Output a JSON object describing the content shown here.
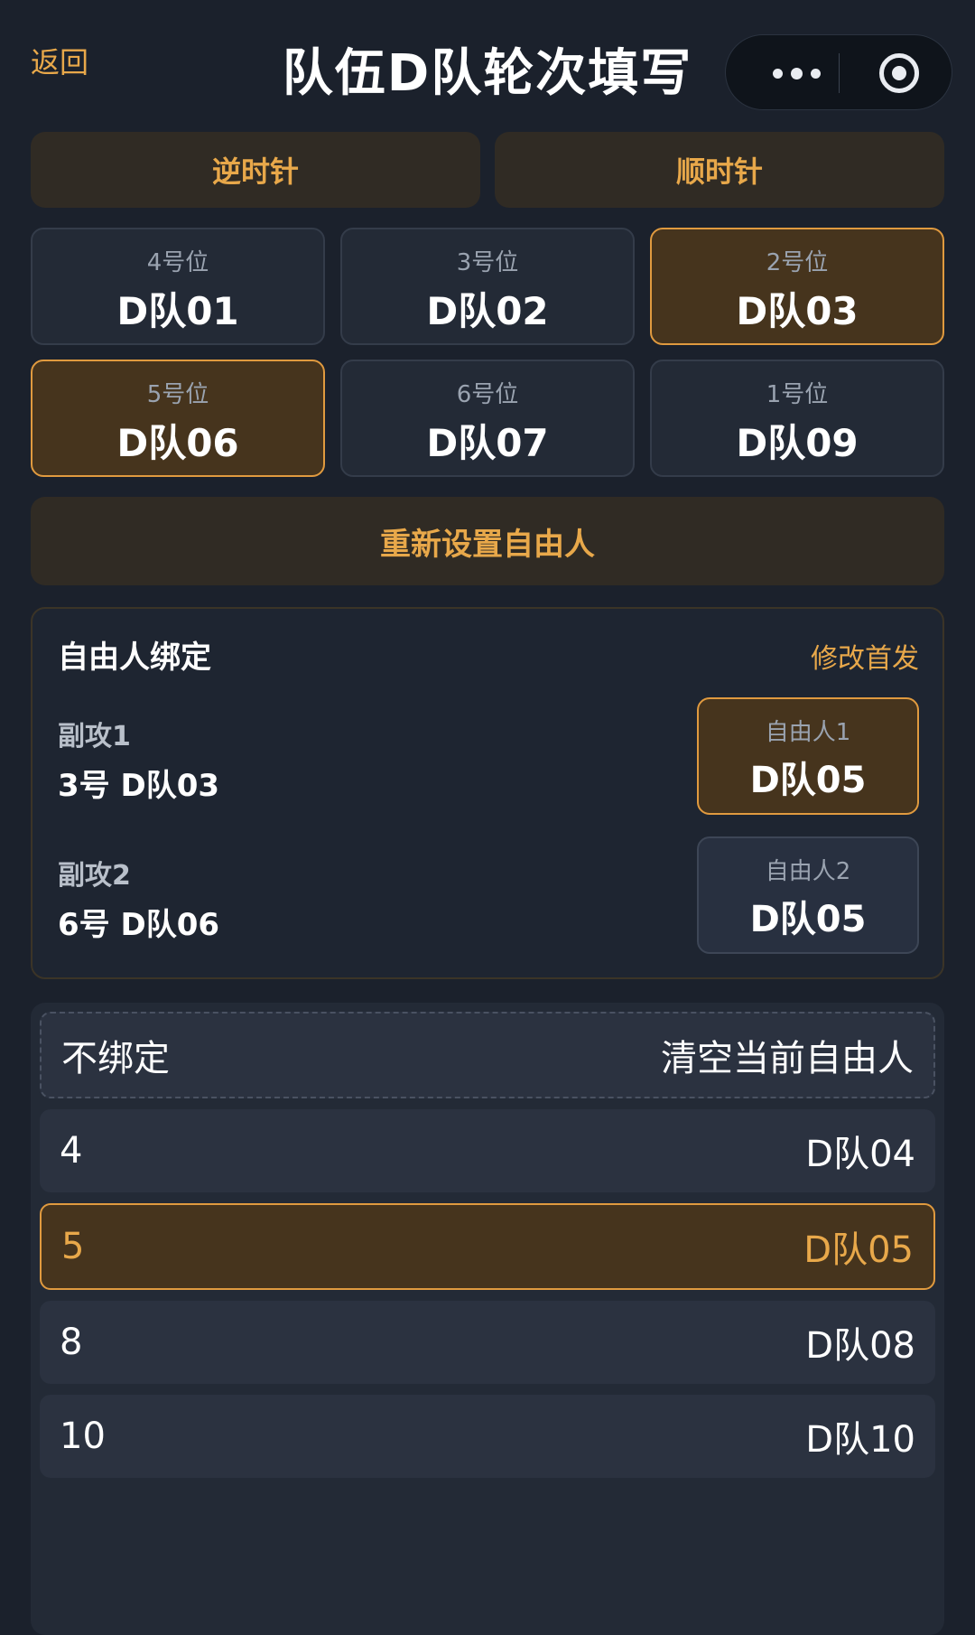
{
  "header": {
    "back": "返回",
    "title": "队伍D队轮次填写"
  },
  "direction": {
    "ccw": "逆时针",
    "cw": "顺时针"
  },
  "positions": [
    {
      "label": "4号位",
      "player": "D队01",
      "highlighted": false
    },
    {
      "label": "3号位",
      "player": "D队02",
      "highlighted": false
    },
    {
      "label": "2号位",
      "player": "D队03",
      "highlighted": true
    },
    {
      "label": "5号位",
      "player": "D队06",
      "highlighted": true
    },
    {
      "label": "6号位",
      "player": "D队07",
      "highlighted": false
    },
    {
      "label": "1号位",
      "player": "D队09",
      "highlighted": false
    }
  ],
  "reset_label": "重新设置自由人",
  "binding": {
    "title": "自由人绑定",
    "edit": "修改首发",
    "rows": [
      {
        "label": "副攻1",
        "value": "3号 D队03",
        "libero_label": "自由人1",
        "libero": "D队05",
        "highlighted": true
      },
      {
        "label": "副攻2",
        "value": "6号 D队06",
        "libero_label": "自由人2",
        "libero": "D队05",
        "highlighted": false
      }
    ]
  },
  "options": {
    "unbind": {
      "left": "不绑定",
      "right": "清空当前自由人"
    },
    "items": [
      {
        "num": "4",
        "name": "D队04",
        "selected": false
      },
      {
        "num": "5",
        "name": "D队05",
        "selected": true
      },
      {
        "num": "8",
        "name": "D队08",
        "selected": false
      },
      {
        "num": "10",
        "name": "D队10",
        "selected": false
      }
    ]
  },
  "colors": {
    "accent": "#e8a84a",
    "background": "#1b212c",
    "highlight_fill": "#46341d"
  }
}
